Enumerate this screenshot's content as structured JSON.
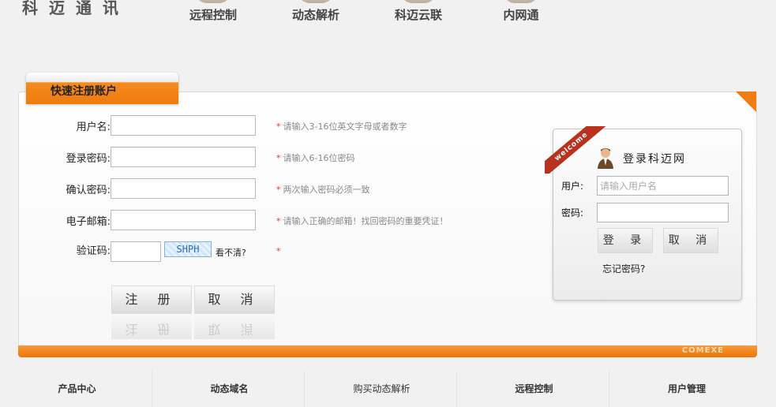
{
  "logo": "科迈通讯",
  "nav": [
    "远程控制",
    "动态解析",
    "科迈云联",
    "内网通"
  ],
  "register": {
    "tab_title": "快速注册账户",
    "fields": [
      {
        "label": "用户名:",
        "hint": "请输入3-16位英文字母或者数字"
      },
      {
        "label": "登录密码:",
        "hint": "请输入6-16位密码"
      },
      {
        "label": "确认密码:",
        "hint": "两次输入密码必须一致"
      },
      {
        "label": "电子邮箱:",
        "hint": "请输入正确的邮箱！找回密码的重要凭证！"
      }
    ],
    "captcha_label": "验证码:",
    "captcha_text": "SHPH",
    "captcha_unclear": "看不清?",
    "required_mark": "*",
    "submit": "注 册",
    "cancel": "取 消"
  },
  "login": {
    "ribbon": "welcome",
    "title": "登录科迈网",
    "user_label": "用户:",
    "user_placeholder": "请输入用户名",
    "pass_label": "密码:",
    "login_btn": "登 录",
    "cancel_btn": "取 消",
    "forgot": "忘记密码?"
  },
  "footer_brand": "COMEXE",
  "bottom_nav": [
    "产品中心",
    "动态域名",
    "购买动态解析",
    "远程控制",
    "用户管理"
  ]
}
